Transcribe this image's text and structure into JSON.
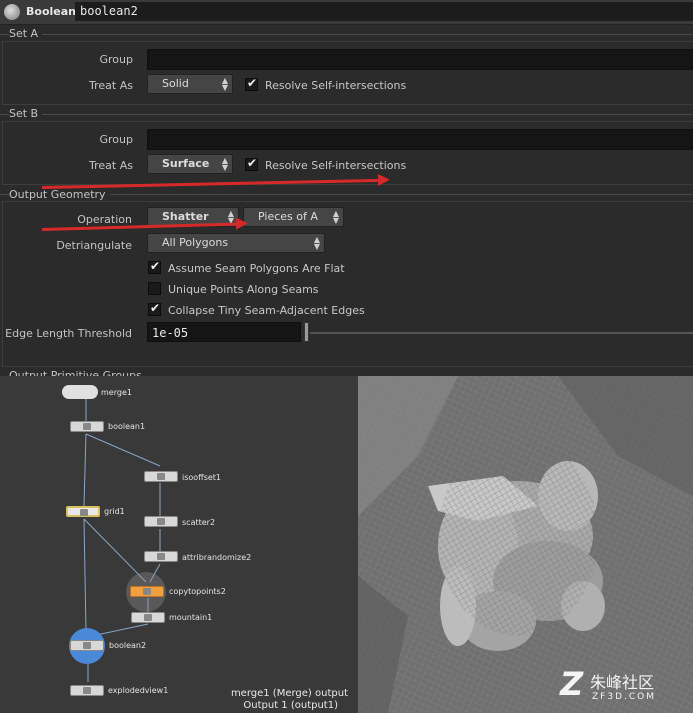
{
  "header": {
    "node_type": "Boolean",
    "node_name": "boolean2"
  },
  "set_a": {
    "title": "Set A",
    "group_label": "Group",
    "treat_as_label": "Treat As",
    "treat_as_value": "Solid",
    "resolve_checked": true,
    "resolve_label": "Resolve Self-intersections"
  },
  "set_b": {
    "title": "Set B",
    "group_label": "Group",
    "treat_as_label": "Treat As",
    "treat_as_value": "Surface",
    "resolve_checked": true,
    "resolve_label": "Resolve Self-intersections"
  },
  "output_geometry": {
    "title": "Output Geometry",
    "operation_label": "Operation",
    "operation_value": "Shatter",
    "operation_sub_value": "Pieces of A",
    "detriangulate_label": "Detriangulate",
    "detriangulate_value": "All Polygons",
    "options": [
      {
        "label": "Assume Seam Polygons Are Flat",
        "checked": true
      },
      {
        "label": "Unique Points Along Seams",
        "checked": false
      },
      {
        "label": "Collapse Tiny Seam-Adjacent Edges",
        "checked": true
      }
    ],
    "edge_threshold_label": "Edge Length Threshold",
    "edge_threshold_value": "1e-05"
  },
  "output_primitive_groups": {
    "title": "Output Primitive Groups"
  },
  "network": {
    "nodes": [
      {
        "name": "merge1"
      },
      {
        "name": "boolean1"
      },
      {
        "name": "isooffset1"
      },
      {
        "name": "grid1"
      },
      {
        "name": "scatter2"
      },
      {
        "name": "attribrandomize2"
      },
      {
        "name": "copytopoints2"
      },
      {
        "name": "mountain1"
      },
      {
        "name": "boolean2"
      },
      {
        "name": "explodedview1"
      }
    ]
  },
  "viewport": {
    "output_line1": "merge1 (Merge) output",
    "output_line2": "Output 1 (output1)"
  },
  "watermark": {
    "logo": "Z",
    "chinese": "朱峰社区",
    "url": "ZF3D.COM"
  },
  "colors": {
    "arrow": "#d62a2a",
    "panel_bg": "#2b2b2b",
    "node_selected": "#f0a040",
    "node_display": "#4a88d8",
    "node_grid": "#d8c060"
  }
}
